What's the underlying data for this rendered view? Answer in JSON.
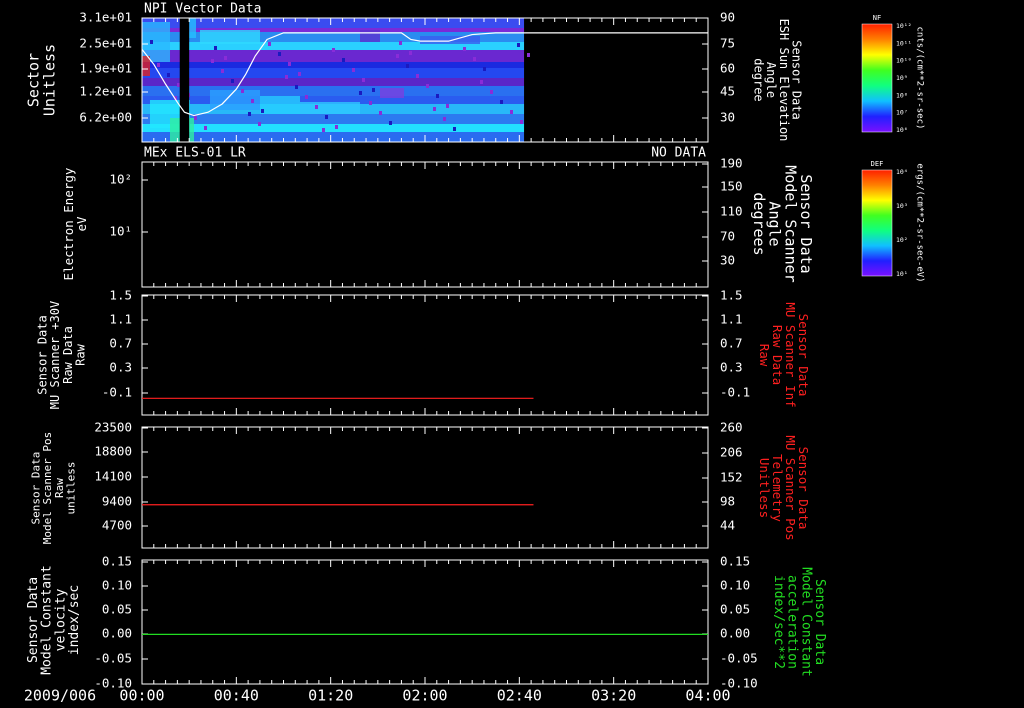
{
  "colors": {
    "background": "#000000",
    "axis": "#ffffff",
    "red": "#ff2020",
    "green": "#22dd22"
  },
  "chart_data": [
    {
      "type": "heatmap",
      "title": "NPI Vector Data",
      "left_label": [
        "Sector",
        "Unitless"
      ],
      "right_label": [
        "Sensor Data",
        "ESH Sun Elevation",
        "Angle",
        "degree"
      ],
      "y_ticks": [
        "3.1e+01",
        "2.5e+01",
        "1.9e+01",
        "1.2e+01",
        "6.2e+00"
      ],
      "y2_ticks": [
        "90",
        "75",
        "60",
        "45",
        "30"
      ],
      "y2lim": [
        15,
        90
      ],
      "data_end_minutes": 162,
      "gap_minutes": [
        16,
        20
      ],
      "line_series": {
        "name": "ESH Sun Elevation Angle",
        "x": [
          0,
          5,
          10,
          15,
          18,
          22,
          28,
          34,
          40,
          44,
          48,
          53,
          60,
          70,
          80,
          90,
          98,
          105,
          110,
          114,
          118,
          121,
          125,
          130,
          140,
          150,
          160,
          170,
          180,
          200,
          220,
          240
        ],
        "y": [
          71,
          62,
          50,
          39,
          33,
          31,
          33,
          38,
          47,
          56,
          67,
          77,
          81,
          81,
          81,
          81,
          81,
          81,
          81,
          77,
          76,
          76,
          76,
          76,
          80,
          81,
          81,
          81,
          81,
          81,
          81,
          81
        ]
      },
      "colorbar": {
        "title": "NF",
        "unit": "cnts/(cm**2-sr-sec)",
        "tick_labels": [
          "10¹²",
          "10¹¹",
          "10¹⁰",
          "10⁹",
          "10⁸",
          "10⁷",
          "10⁶"
        ]
      }
    },
    {
      "type": "line",
      "title": "MEx ELS-01 LR",
      "status": "NO DATA",
      "left_label": [
        "Electron Energy",
        "eV"
      ],
      "right_label": [
        "Sensor Data",
        "Model Scanner",
        "Angle",
        "degrees"
      ],
      "y_ticks": [
        "10²",
        "10¹"
      ],
      "y2_ticks": [
        "190",
        "150",
        "110",
        "70",
        "30"
      ],
      "y2lim": [
        10,
        190
      ],
      "line_series": {
        "name": "Model Scanner Angle",
        "x": [
          0,
          240
        ],
        "y": [
          10,
          10
        ]
      },
      "colorbar": {
        "title": "DEF",
        "unit": "ergs/(cm**2-sr-sec-eV)",
        "tick_labels": [
          "10⁴",
          "10³",
          "10²",
          "10¹"
        ]
      }
    },
    {
      "type": "line",
      "left_label": [
        "Sensor Data",
        "MU Scanner +30V",
        "Raw Data",
        "Raw"
      ],
      "right_label": [
        "Sensor Data",
        "MU Scanner Inf",
        "Raw Data",
        "Raw"
      ],
      "y_ticks": [
        "1.5",
        "1.1",
        "0.7",
        "0.3",
        "-0.1"
      ],
      "y2_ticks": [
        "1.5",
        "1.1",
        "0.7",
        "0.3",
        "-0.1"
      ],
      "ylim": [
        -0.3,
        1.5
      ],
      "series": [
        {
          "x": [
            0,
            166
          ],
          "values": [
            -0.05,
            -0.05
          ]
        }
      ]
    },
    {
      "type": "line",
      "left_label": [
        "Sensor Data",
        "Model Scanner Pos",
        "Raw",
        "unitless"
      ],
      "right_label": [
        "Sensor Data",
        "MU Scanner Pos",
        "Telemetry",
        "Unitless"
      ],
      "y_ticks": [
        "23500",
        "18800",
        "14100",
        "9400",
        "4700"
      ],
      "y2_ticks": [
        "260",
        "206",
        "152",
        "98",
        "44"
      ],
      "ylim": [
        0,
        23500
      ],
      "series": [
        {
          "x": [
            0,
            166
          ],
          "values": [
            8400,
            8400
          ]
        }
      ]
    },
    {
      "type": "line",
      "left_label": [
        "Sensor Data",
        "Model Constant",
        "velocity",
        "index/sec"
      ],
      "right_label": [
        "Sensor Data",
        "Model Constant",
        "acceleration",
        "index/sec**2"
      ],
      "y_ticks": [
        "0.15",
        "0.10",
        "0.05",
        "0.00",
        "-0.05",
        "-0.10"
      ],
      "y2_ticks": [
        "0.15",
        "0.10",
        "0.05",
        "0.00",
        "-0.05",
        "-0.10"
      ],
      "ylim": [
        -0.1,
        0.15
      ],
      "series": [
        {
          "x": [
            0,
            240
          ],
          "values": [
            0,
            0
          ]
        }
      ]
    }
  ],
  "time_axis": {
    "date": "2009/006",
    "labels": [
      "00:00",
      "00:40",
      "01:20",
      "02:00",
      "02:40",
      "03:20",
      "04:00"
    ]
  }
}
